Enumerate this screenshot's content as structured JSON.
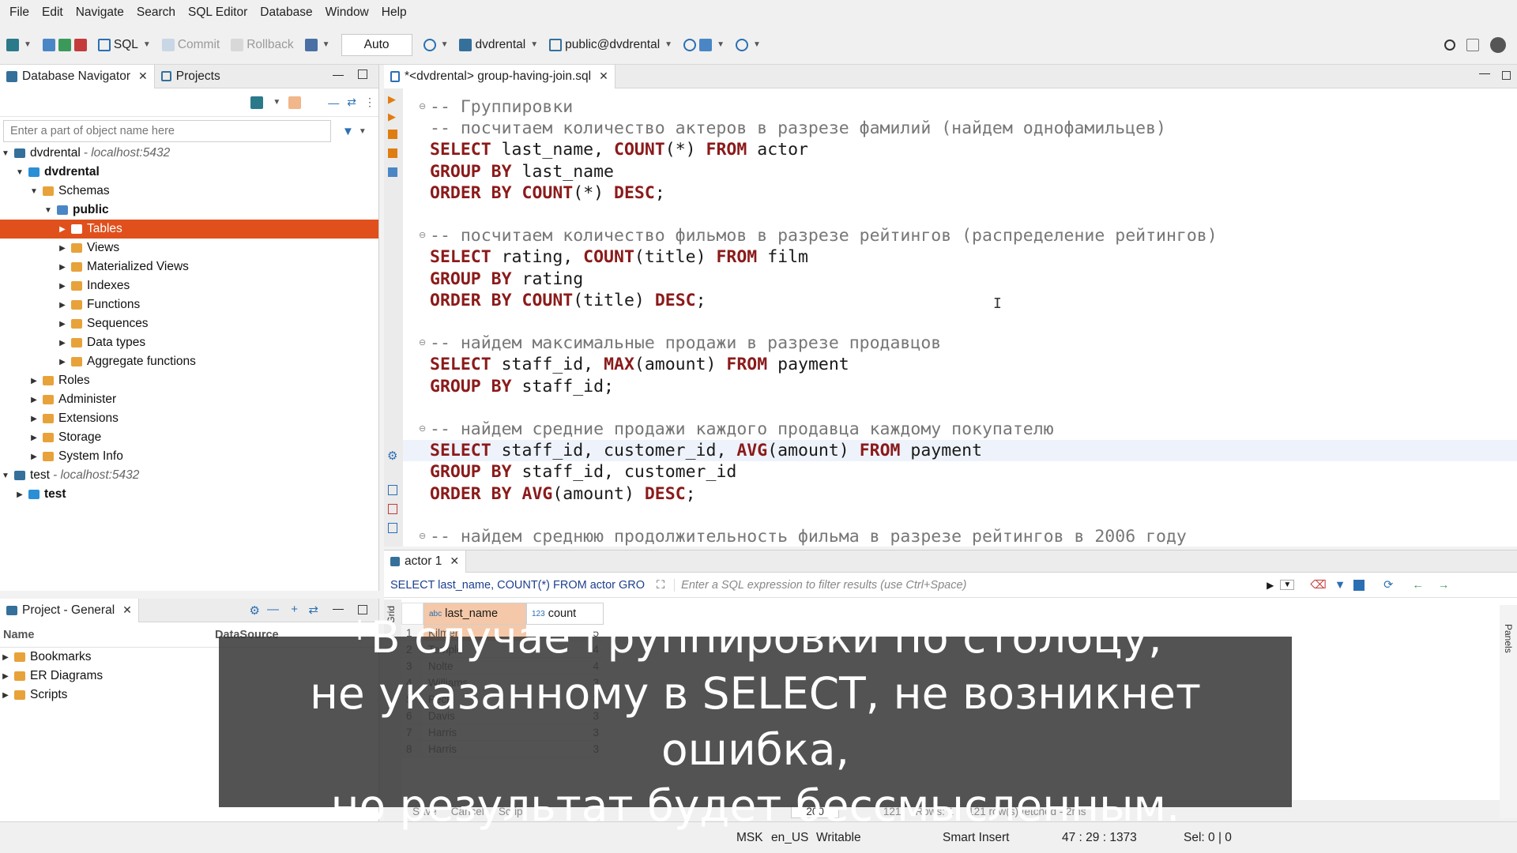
{
  "menu": [
    "File",
    "Edit",
    "Navigate",
    "Search",
    "SQL Editor",
    "Database",
    "Window",
    "Help"
  ],
  "toolbar": {
    "sql_label": "SQL",
    "commit_label": "Commit",
    "rollback_label": "Rollback",
    "auto_label": "Auto",
    "datasource": "dvdrental",
    "schema": "public@dvdrental"
  },
  "navigator": {
    "tab_label": "Database Navigator",
    "projects_tab": "Projects",
    "search_placeholder": "Enter a part of object name here",
    "tree": [
      {
        "label": "dvdrental",
        "host": "- localhost:5432",
        "level": 0,
        "arrow": "▼",
        "bold": false,
        "icon": "db-connection-icon"
      },
      {
        "label": "dvdrental",
        "level": 1,
        "arrow": "▼",
        "bold": true,
        "icon": "database-icon"
      },
      {
        "label": "Schemas",
        "level": 2,
        "arrow": "▼",
        "bold": false,
        "icon": "folder-icon"
      },
      {
        "label": "public",
        "level": 3,
        "arrow": "▼",
        "bold": true,
        "icon": "schema-icon"
      },
      {
        "label": "Tables",
        "level": 4,
        "arrow": "▶",
        "bold": false,
        "icon": "table-icon",
        "selected": true
      },
      {
        "label": "Views",
        "level": 4,
        "arrow": "▶",
        "bold": false,
        "icon": "view-icon"
      },
      {
        "label": "Materialized Views",
        "level": 4,
        "arrow": "▶",
        "bold": false,
        "icon": "view-icon"
      },
      {
        "label": "Indexes",
        "level": 4,
        "arrow": "▶",
        "bold": false,
        "icon": "folder-icon"
      },
      {
        "label": "Functions",
        "level": 4,
        "arrow": "▶",
        "bold": false,
        "icon": "folder-icon"
      },
      {
        "label": "Sequences",
        "level": 4,
        "arrow": "▶",
        "bold": false,
        "icon": "folder-icon"
      },
      {
        "label": "Data types",
        "level": 4,
        "arrow": "▶",
        "bold": false,
        "icon": "folder-icon"
      },
      {
        "label": "Aggregate functions",
        "level": 4,
        "arrow": "▶",
        "bold": false,
        "icon": "folder-icon"
      },
      {
        "label": "Roles",
        "level": 2,
        "arrow": "▶",
        "bold": false,
        "icon": "folder-icon"
      },
      {
        "label": "Administer",
        "level": 2,
        "arrow": "▶",
        "bold": false,
        "icon": "folder-icon"
      },
      {
        "label": "Extensions",
        "level": 2,
        "arrow": "▶",
        "bold": false,
        "icon": "folder-icon"
      },
      {
        "label": "Storage",
        "level": 2,
        "arrow": "▶",
        "bold": false,
        "icon": "folder-icon"
      },
      {
        "label": "System Info",
        "level": 2,
        "arrow": "▶",
        "bold": false,
        "icon": "folder-icon"
      },
      {
        "label": "test",
        "host": "- localhost:5432",
        "level": 0,
        "arrow": "▼",
        "bold": false,
        "icon": "db-connection-icon"
      },
      {
        "label": "test",
        "level": 1,
        "arrow": "▶",
        "bold": true,
        "icon": "database-icon"
      }
    ]
  },
  "project": {
    "tab_label": "Project - General",
    "col_name": "Name",
    "col_datasource": "DataSource",
    "items": [
      "Bookmarks",
      "ER Diagrams",
      "Scripts"
    ]
  },
  "editor": {
    "tab_label": "*<dvdrental> group-having-join.sql",
    "lines": [
      [
        {
          "t": "-- Группировки",
          "c": "cm"
        }
      ],
      [
        {
          "t": "-- посчитаем количество актеров в разрезе фамилий (найдем однофамильцев)",
          "c": "cm"
        }
      ],
      [
        {
          "t": "SELECT",
          "c": "kw"
        },
        {
          "t": " last_name, ",
          "c": ""
        },
        {
          "t": "COUNT",
          "c": "kw"
        },
        {
          "t": "(*) ",
          "c": ""
        },
        {
          "t": "FROM",
          "c": "kw"
        },
        {
          "t": " actor",
          "c": ""
        }
      ],
      [
        {
          "t": "GROUP BY",
          "c": "kw"
        },
        {
          "t": " last_name",
          "c": ""
        }
      ],
      [
        {
          "t": "ORDER BY",
          "c": "kw"
        },
        {
          "t": " ",
          "c": ""
        },
        {
          "t": "COUNT",
          "c": "kw"
        },
        {
          "t": "(*) ",
          "c": ""
        },
        {
          "t": "DESC",
          "c": "kw"
        },
        {
          "t": ";",
          "c": ""
        }
      ],
      [],
      [
        {
          "t": "-- посчитаем количество фильмов в разрезе рейтингов (распределение рейтингов)",
          "c": "cm"
        }
      ],
      [
        {
          "t": "SELECT",
          "c": "kw"
        },
        {
          "t": " rating, ",
          "c": ""
        },
        {
          "t": "COUNT",
          "c": "kw"
        },
        {
          "t": "(title) ",
          "c": ""
        },
        {
          "t": "FROM",
          "c": "kw"
        },
        {
          "t": " film",
          "c": ""
        }
      ],
      [
        {
          "t": "GROUP BY",
          "c": "kw"
        },
        {
          "t": " rating",
          "c": ""
        }
      ],
      [
        {
          "t": "ORDER BY",
          "c": "kw"
        },
        {
          "t": " ",
          "c": ""
        },
        {
          "t": "COUNT",
          "c": "kw"
        },
        {
          "t": "(title) ",
          "c": ""
        },
        {
          "t": "DESC",
          "c": "kw"
        },
        {
          "t": ";",
          "c": ""
        }
      ],
      [],
      [
        {
          "t": "-- найдем максимальные продажи в разрезе продавцов",
          "c": "cm"
        }
      ],
      [
        {
          "t": "SELECT",
          "c": "kw"
        },
        {
          "t": " staff_id, ",
          "c": ""
        },
        {
          "t": "MAX",
          "c": "kw"
        },
        {
          "t": "(amount) ",
          "c": ""
        },
        {
          "t": "FROM",
          "c": "kw"
        },
        {
          "t": " payment",
          "c": ""
        }
      ],
      [
        {
          "t": "GROUP BY",
          "c": "kw"
        },
        {
          "t": " staff_id;",
          "c": ""
        }
      ],
      [],
      [
        {
          "t": "-- найдем средние продажи каждого продавца каждому покупателю",
          "c": "cm"
        }
      ],
      [
        {
          "t": "SELECT",
          "c": "kw"
        },
        {
          "t": " staff_id, customer_id, ",
          "c": ""
        },
        {
          "t": "AVG",
          "c": "kw"
        },
        {
          "t": "(amount) ",
          "c": ""
        },
        {
          "t": "FROM",
          "c": "kw"
        },
        {
          "t": " payment",
          "c": ""
        }
      ],
      [
        {
          "t": "GROUP BY",
          "c": "kw"
        },
        {
          "t": " staff_id, customer_id",
          "c": ""
        }
      ],
      [
        {
          "t": "ORDER BY",
          "c": "kw"
        },
        {
          "t": " ",
          "c": ""
        },
        {
          "t": "AVG",
          "c": "kw"
        },
        {
          "t": "(amount) ",
          "c": ""
        },
        {
          "t": "DESC",
          "c": "kw"
        },
        {
          "t": ";",
          "c": ""
        }
      ],
      [],
      [
        {
          "t": "-- найдем среднюю продолжительность фильма в разрезе рейтингов в 2006 году",
          "c": "cm"
        }
      ]
    ]
  },
  "results": {
    "tab_label": "actor 1",
    "query": "SELECT last_name, COUNT(*) FROM actor GRO",
    "filter_placeholder": "Enter a SQL expression to filter results (use Ctrl+Space)",
    "side_tab": "Grid",
    "columns": [
      "last_name",
      "count"
    ],
    "rows": [
      [
        "1",
        "Kilmer",
        "5"
      ],
      [
        "2",
        "Temple",
        "4"
      ],
      [
        "3",
        "Nolte",
        "4"
      ],
      [
        "4",
        "Williams",
        "3"
      ],
      [
        "5",
        "Peck",
        "3"
      ],
      [
        "6",
        "Davis",
        "3"
      ],
      [
        "7",
        "Harris",
        "3"
      ],
      [
        "8",
        "Harris",
        "3"
      ]
    ],
    "bottom": {
      "save": "Save",
      "cancel": "Cancel",
      "script": "Script",
      "limit": "200",
      "count": "121",
      "rows": "Rows: 1",
      "fetched": "121 row(s) fetched - 2ms"
    }
  },
  "status": {
    "tz": "MSK",
    "locale": "en_US",
    "mode": "Writable",
    "insert": "Smart Insert",
    "pos": "47 : 29 : 1373",
    "sel": "Sel: 0 | 0"
  },
  "subtitle": {
    "line1": "*В случае группировки по столбцу,",
    "line2": "не указанному в SELECT, не возникнет ошибка,",
    "line3": "но результат будет бессмысленным."
  },
  "colors": {
    "selection": "#e0501d",
    "keyword": "#8b1a1a",
    "comment": "#777777",
    "query": "#1d3f8f"
  }
}
